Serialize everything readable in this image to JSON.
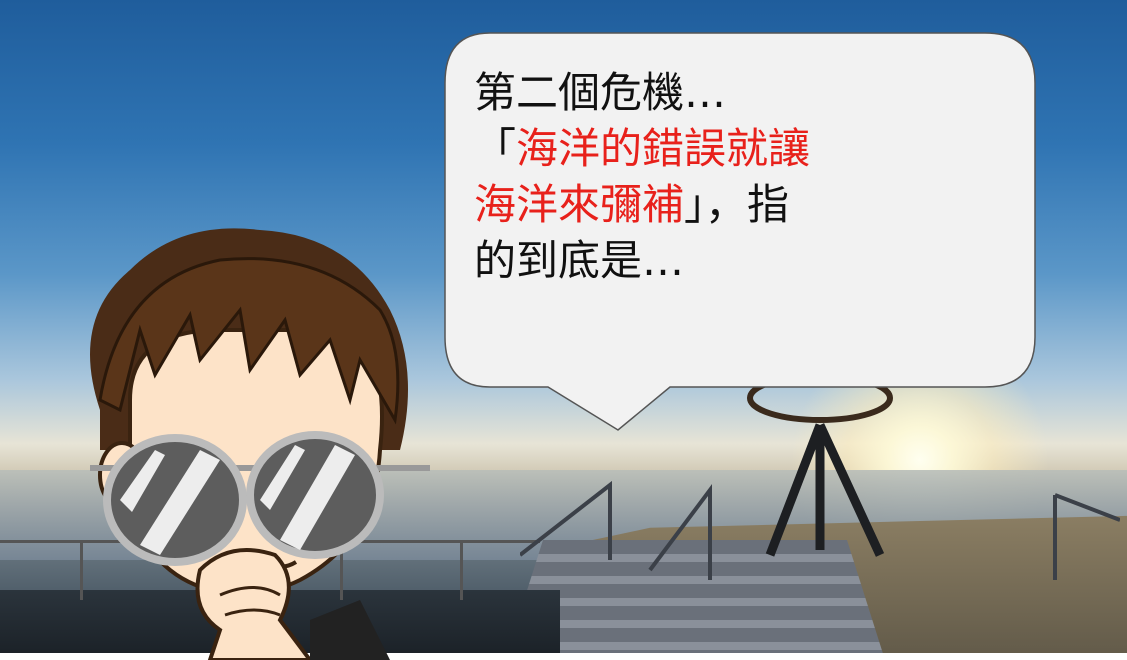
{
  "speech_bubble": {
    "line1": "第二個危機…",
    "line2_open": "「",
    "line2_red": "海洋的錯誤就讓",
    "line3_red": "海洋來彌補",
    "line3_close": "」，指",
    "line4": "的到底是…"
  },
  "colors": {
    "highlight": "#e8211b",
    "text": "#111111",
    "bubble_fill": "#f2f2f2",
    "bubble_stroke": "#555555"
  }
}
